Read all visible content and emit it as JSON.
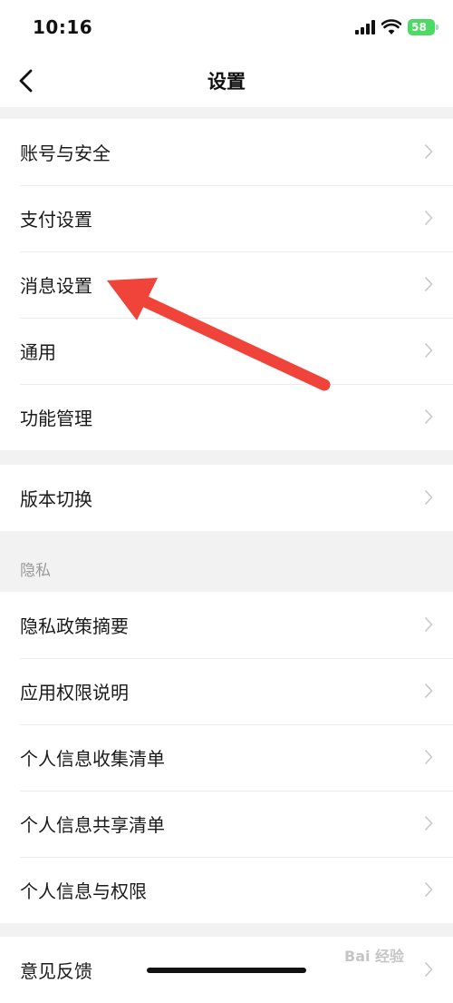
{
  "status_bar": {
    "time": "10:16",
    "battery": "58"
  },
  "nav": {
    "title": "设置"
  },
  "group1": {
    "items": [
      {
        "label": "账号与安全"
      },
      {
        "label": "支付设置"
      },
      {
        "label": "消息设置"
      },
      {
        "label": "通用"
      },
      {
        "label": "功能管理"
      }
    ]
  },
  "group2": {
    "items": [
      {
        "label": "版本切换"
      }
    ]
  },
  "privacy": {
    "header": "隐私",
    "items": [
      {
        "label": "隐私政策摘要"
      },
      {
        "label": "应用权限说明"
      },
      {
        "label": "个人信息收集清单"
      },
      {
        "label": "个人信息共享清单"
      },
      {
        "label": "个人信息与权限"
      }
    ]
  },
  "group4": {
    "items": [
      {
        "label": "意见反馈"
      }
    ]
  },
  "annotation": {
    "color": "#f0433a"
  },
  "watermark": "Bai 经验"
}
